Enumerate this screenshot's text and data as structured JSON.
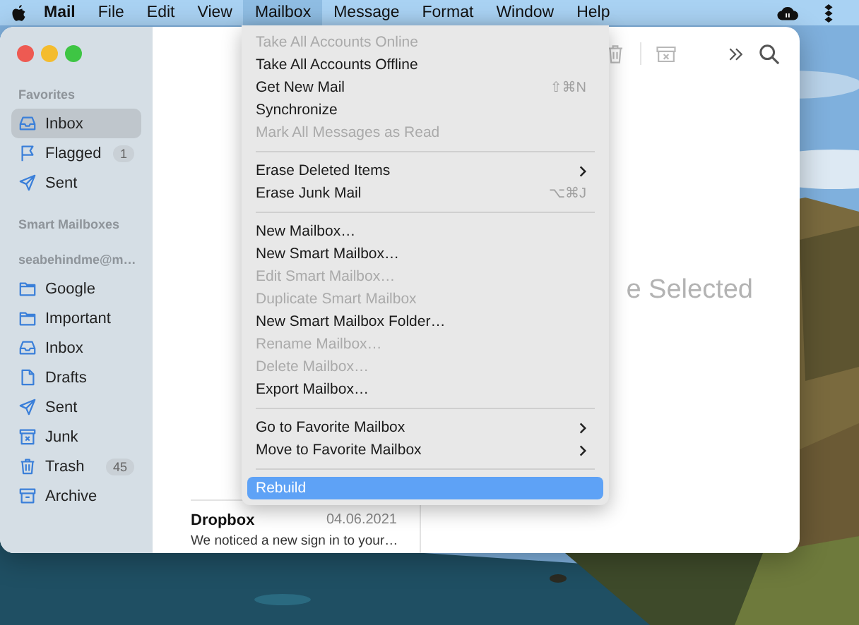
{
  "menu_bar": {
    "items": [
      {
        "label": "Mail",
        "selected": false
      },
      {
        "label": "File",
        "selected": false
      },
      {
        "label": "Edit",
        "selected": false
      },
      {
        "label": "View",
        "selected": false
      },
      {
        "label": "Mailbox",
        "selected": true
      },
      {
        "label": "Message",
        "selected": false
      },
      {
        "label": "Format",
        "selected": false
      },
      {
        "label": "Window",
        "selected": false
      },
      {
        "label": "Help",
        "selected": false
      }
    ]
  },
  "mailbox_menu": {
    "items": [
      {
        "kind": "item",
        "label": "Take All Accounts Online",
        "disabled": true,
        "selected": false
      },
      {
        "kind": "item",
        "label": "Take All Accounts Offline",
        "disabled": false,
        "selected": false
      },
      {
        "kind": "item",
        "label": "Get New Mail",
        "shortcut": "⇧⌘N",
        "disabled": false,
        "selected": false
      },
      {
        "kind": "item",
        "label": "Synchronize",
        "disabled": false,
        "selected": false
      },
      {
        "kind": "item",
        "label": "Mark All Messages as Read",
        "disabled": true,
        "selected": false
      },
      {
        "kind": "separator"
      },
      {
        "kind": "item",
        "label": "Erase Deleted Items",
        "submenu": true,
        "disabled": false,
        "selected": false
      },
      {
        "kind": "item",
        "label": "Erase Junk Mail",
        "shortcut": "⌥⌘J",
        "disabled": false,
        "selected": false
      },
      {
        "kind": "separator"
      },
      {
        "kind": "item",
        "label": "New Mailbox…",
        "disabled": false,
        "selected": false
      },
      {
        "kind": "item",
        "label": "New Smart Mailbox…",
        "disabled": false,
        "selected": false
      },
      {
        "kind": "item",
        "label": "Edit Smart Mailbox…",
        "disabled": true,
        "selected": false
      },
      {
        "kind": "item",
        "label": "Duplicate Smart Mailbox",
        "disabled": true,
        "selected": false
      },
      {
        "kind": "item",
        "label": "New Smart Mailbox Folder…",
        "disabled": false,
        "selected": false
      },
      {
        "kind": "item",
        "label": "Rename Mailbox…",
        "disabled": true,
        "selected": false
      },
      {
        "kind": "item",
        "label": "Delete Mailbox…",
        "disabled": true,
        "selected": false
      },
      {
        "kind": "item",
        "label": "Export Mailbox…",
        "disabled": false,
        "selected": false
      },
      {
        "kind": "separator"
      },
      {
        "kind": "item",
        "label": "Go to Favorite Mailbox",
        "submenu": true,
        "disabled": false,
        "selected": false
      },
      {
        "kind": "item",
        "label": "Move to Favorite Mailbox",
        "submenu": true,
        "disabled": false,
        "selected": false
      },
      {
        "kind": "separator"
      },
      {
        "kind": "item",
        "label": "Rebuild",
        "disabled": false,
        "selected": true
      }
    ]
  },
  "sidebar": {
    "sections": [
      {
        "title": "Favorites",
        "items": [
          {
            "kind": "inbox",
            "label": "Inbox",
            "selected": true
          },
          {
            "kind": "flag",
            "label": "Flagged",
            "badge": "1",
            "selected": false
          },
          {
            "kind": "sent",
            "label": "Sent",
            "selected": false
          }
        ]
      },
      {
        "title": "Smart Mailboxes"
      },
      {
        "title": "seabehindme@m…",
        "items": [
          {
            "kind": "folder",
            "label": "Google",
            "selected": false
          },
          {
            "kind": "folder",
            "label": "Important",
            "selected": false
          },
          {
            "kind": "inbox",
            "label": "Inbox",
            "selected": false
          },
          {
            "kind": "drafts",
            "label": "Drafts",
            "selected": false
          },
          {
            "kind": "sent",
            "label": "Sent",
            "selected": false
          },
          {
            "kind": "junk",
            "label": "Junk",
            "selected": false
          },
          {
            "kind": "trash",
            "label": "Trash",
            "badge": "45",
            "selected": false
          },
          {
            "kind": "archive",
            "label": "Archive",
            "selected": false
          }
        ]
      }
    ]
  },
  "message_list": {
    "messages": [
      {
        "sender": "Dropbox",
        "date": "04.06.2021",
        "preview": "We noticed a new sign in to your…"
      }
    ]
  },
  "viewer": {
    "empty_message": "e Selected"
  }
}
